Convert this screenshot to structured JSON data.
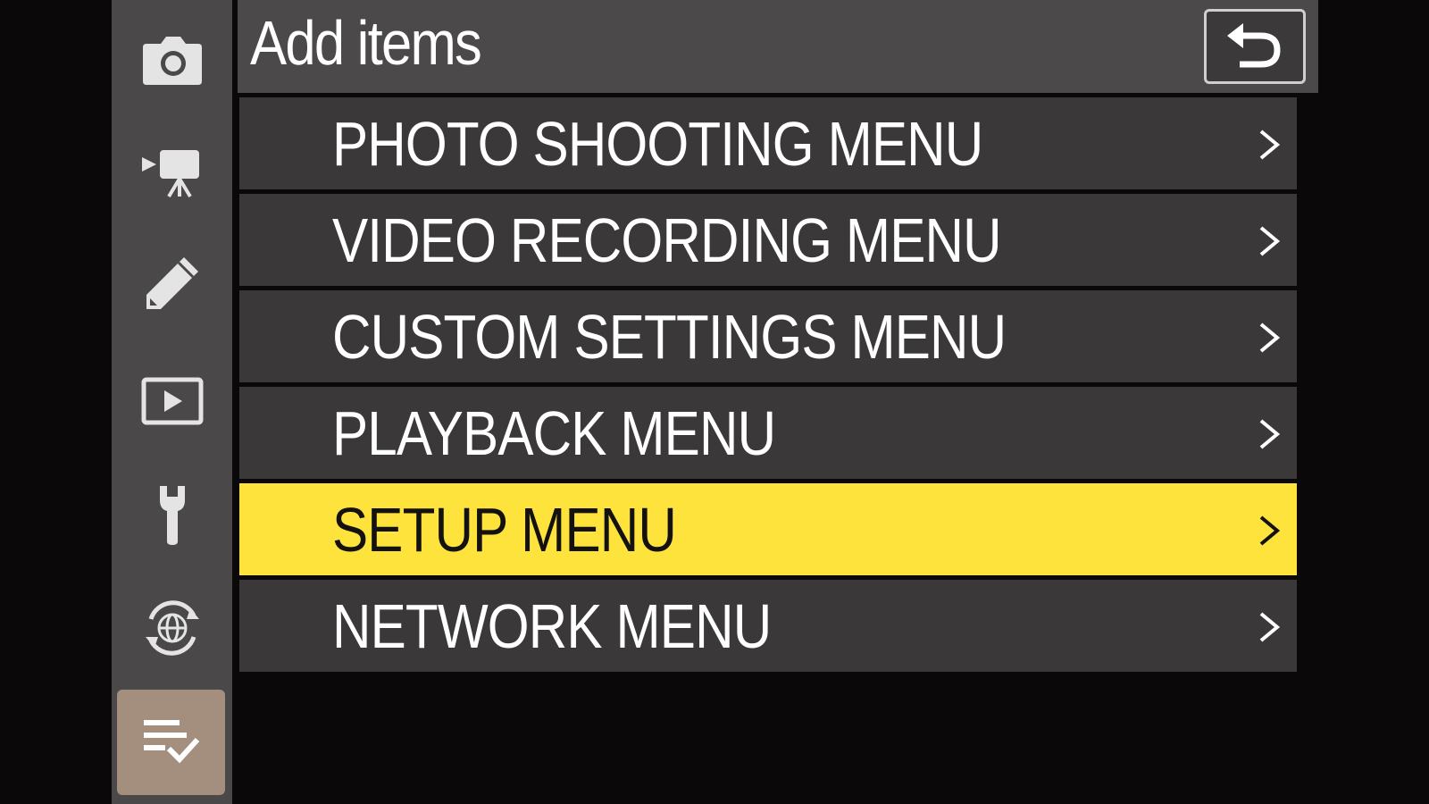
{
  "header": {
    "title": "Add items",
    "back_icon": "back-arrow-icon"
  },
  "tabs": [
    {
      "icon": "camera-icon",
      "active": false
    },
    {
      "icon": "video-camera-icon",
      "active": false
    },
    {
      "icon": "pencil-icon",
      "active": false
    },
    {
      "icon": "playback-icon",
      "active": false
    },
    {
      "icon": "wrench-icon",
      "active": false
    },
    {
      "icon": "network-globe-icon",
      "active": false
    },
    {
      "icon": "my-menu-checklist-icon",
      "active": true
    }
  ],
  "menu": {
    "items": [
      {
        "label": "PHOTO SHOOTING MENU",
        "selected": false
      },
      {
        "label": "VIDEO RECORDING MENU",
        "selected": false
      },
      {
        "label": "CUSTOM SETTINGS MENU",
        "selected": false
      },
      {
        "label": "PLAYBACK MENU",
        "selected": false
      },
      {
        "label": "SETUP MENU",
        "selected": true
      },
      {
        "label": "NETWORK MENU",
        "selected": false
      }
    ]
  },
  "colors": {
    "background": "#0b0809",
    "tab_strip": "#4a4848",
    "active_tab": "#a48f7e",
    "menu_item": "#3a3838",
    "selected_item": "#fde33b"
  }
}
